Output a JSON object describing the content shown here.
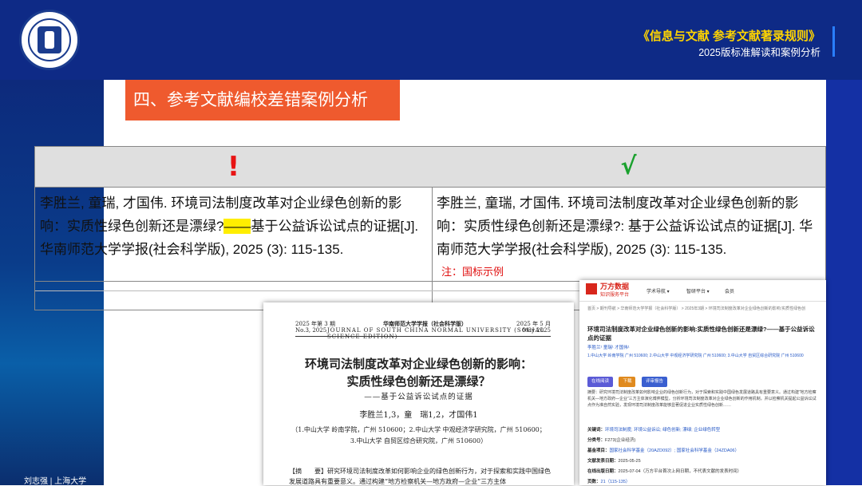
{
  "header": {
    "title": "《信息与文献  参考文献著录规则》",
    "subtitle": "2025版标准解读和案例分析"
  },
  "section_title": "四、参考文献编校差错案例分析",
  "comparison": {
    "wrong_mark": "!",
    "right_mark": "√",
    "wrong": {
      "before": "李胜兰, 童瑞, 才国伟. 环境司法制度改革对企业绿色创新的影响：实质性绿色创新还是漂绿?",
      "highlight": "——",
      "after": "基于公益诉讼试点的证据[J]. 华南师范大学学报(社会科学版), 2025 (3): 115-135."
    },
    "right": {
      "text": "李胜兰, 童瑞, 才国伟. 环境司法制度改革对企业绿色创新的影响：实质性绿色创新还是漂绿?: 基于公益诉讼试点的证据[J]. 华南师范大学学报(社会科学版), 2025 (3): 115-135.",
      "note": "注：国标示例"
    }
  },
  "paper": {
    "issue_l": "2025 年第 3 期",
    "journal_cn": "华南师范大学学报（社会科学版）",
    "date_r": "2025 年 5 月",
    "issue_en": "No.3, 2025",
    "journal_en": "JOURNAL  OF  SOUTH  CHINA  NORMAL  UNIVERSITY (SOCIAL SCIENCE EDITION)",
    "date_en": "May 2025",
    "title_line1": "环境司法制度改革对企业绿色创新的影响：",
    "title_line2": "实质性绿色创新还是漂绿？",
    "subtitle": "——基于公益诉讼试点的证据",
    "authors": "李胜兰1,3，童　瑞1,2，才国伟1",
    "aff1": "（1.中山大学 岭南学院，广州 510600；2.中山大学 中观经济学研究院，广州 510600；",
    "aff2": "3.中山大学 自贸区综合研究院，广州 510600）",
    "abstract": "【摘　　要】研究环境司法制度改革如何影响企业的绿色创新行为，对于探索和实践中国绿色发展道路具有重要意义。通过构建“地方检察机关—地方政府—企业”三方主体"
  },
  "wanfang": {
    "brand": "万方数据",
    "brand_sub": "知识服务平台",
    "nav": [
      "学术导航 ▾",
      "智研平台 ▾",
      "会员"
    ],
    "breadcrumb": "首页 > 期刊导航 > 华南师范大学学报（社会科学版） > 2025年3期 > 环境司法制度改革对企业绿色创新的影响:实质性绿色创",
    "title": "环境司法制度改革对企业绿色创新的影响:实质性绿色创新还是漂绿?——基于公益诉讼点的证据",
    "authors": "李胜兰¹  童瑞¹  才国伟¹",
    "affiliations": "1.中山大学 岭南学院 广州 510600; 2.中山大学 中观经济学研究院 广州 510600; 3.中山大学 自贸区综合研究院 广州 510600",
    "buttons": [
      "在线阅读",
      "下载",
      "评审报告"
    ],
    "abstract": "摘要：研究环境司法制度改革如何影响企业的绿色创新行为，对于探索和实践中国绿色发展道路具有重要意义。通过构建“地方检察机关—地方政府—企业”三方主体演化博弈模型，分析环境司法制度改革对企业绿色创新的作用机制，并以检察机关提起公益诉讼试点作为准自然实验，发现环境司法制度改革能够显著促进企业实质性绿色创新……",
    "keywords_label": "关键词：",
    "keywords": "环境司法制度; 环境公益诉讼; 绿色创新; 漂绿; 企业绿色转型",
    "class_label": "分类号：",
    "class": "F273(企业经济)",
    "fund_label": "基金项目：",
    "fund": "国家社会科学基金（20AZD092）; 国家社会科学基金（24ZDA06）",
    "date_label": "文献发表日期：",
    "date": "2025-05-25",
    "online_label": "在线出版日期：",
    "online": "2025-07-04（万方平台首次上网日期，不代表文献的发表时间）",
    "pages_label": "页数：",
    "pages": "21（115-135）"
  },
  "footer": "刘志强 | 上海大学"
}
